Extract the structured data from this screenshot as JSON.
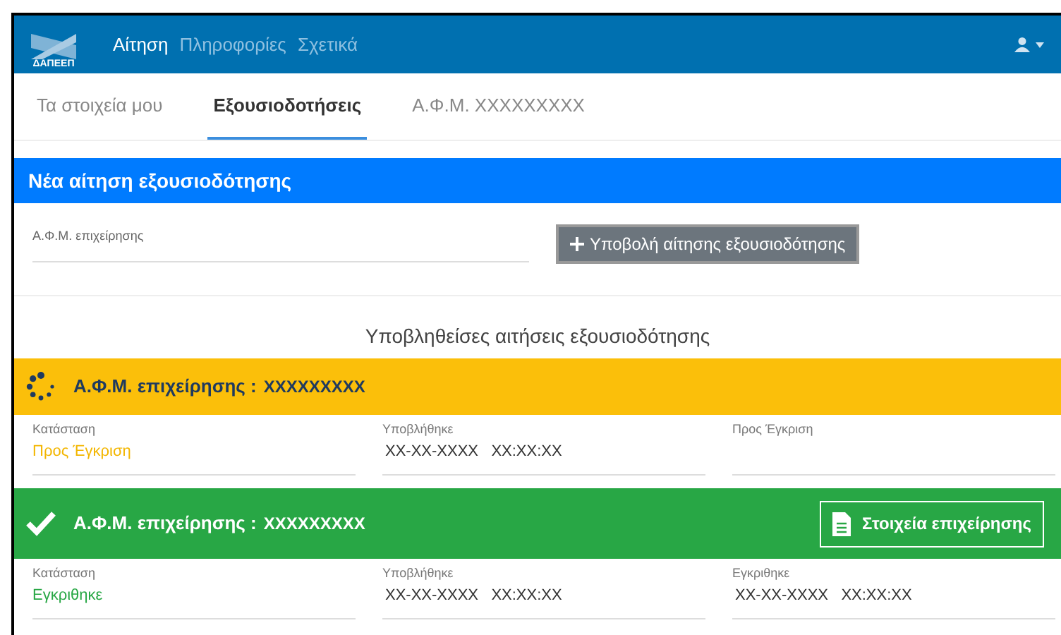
{
  "navbar": {
    "logo_text": "ΔΑΠΕΕΠ",
    "links": [
      {
        "label": "Αίτηση",
        "selected": true
      },
      {
        "label": "Πληροφορίες",
        "selected": false
      },
      {
        "label": "Σχετικά",
        "selected": false
      }
    ]
  },
  "tabs": [
    {
      "label": "Τα στοιχεία μου",
      "selected": false
    },
    {
      "label": "Εξουσιοδοτήσεις",
      "selected": true
    },
    {
      "label": "Α.Φ.Μ. XXXXXXXXX",
      "selected": false
    }
  ],
  "new_request": {
    "title": "Νέα αίτηση εξουσιοδότησης",
    "field_label": "Α.Φ.Μ. επιχείρησης",
    "submit_button": "Υποβολή αίτησης εξουσιοδότησης"
  },
  "submitted_heading": "Υποβληθείσες αιτήσεις εξουσιοδότησης",
  "requests": [
    {
      "kind": "pending",
      "afm_label": "Α.Φ.Μ. επιχείρησης :",
      "afm_value": "XXXXXXXXX",
      "fields": [
        {
          "label": "Κατάσταση",
          "value": "Προς Έγκριση",
          "kind": "status"
        },
        {
          "label": "Υποβλήθηκε",
          "value": "XX-XX-XXXX   XX:XX:XX"
        },
        {
          "label": "Προς Έγκριση"
        }
      ]
    },
    {
      "kind": "approved",
      "afm_label": "Α.Φ.Μ. επιχείρησης :",
      "afm_value": "XXXXXXXXX",
      "button": "Στοιχεία επιχείρησης",
      "fields": [
        {
          "label": "Κατάσταση",
          "value": "Εγκριθηκε",
          "kind": "status"
        },
        {
          "label": "Υποβλήθηκε",
          "value": "XX-XX-XXXX   XX:XX:XX"
        },
        {
          "label": "Εγκριθηκε",
          "value": "XX-XX-XXXX   XX:XX:XX"
        }
      ]
    }
  ]
}
